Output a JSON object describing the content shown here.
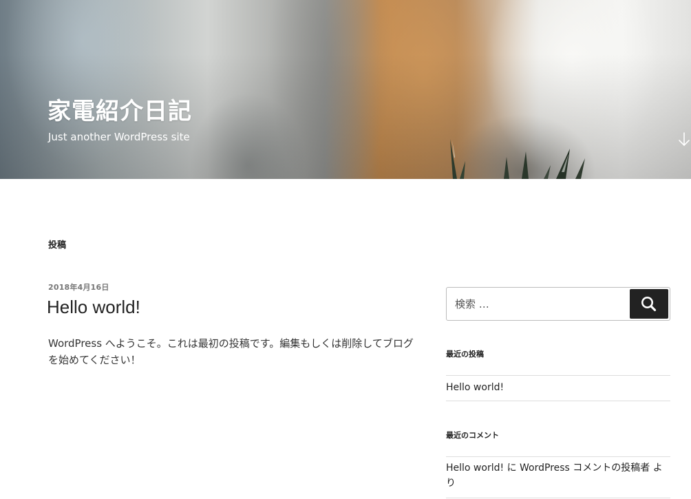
{
  "header": {
    "site_title": "家電紹介日記",
    "site_description": "Just another WordPress site",
    "scroll_icon": "arrow-down-icon"
  },
  "main": {
    "page_title": "投稿",
    "post": {
      "date": "2018年4月16日",
      "title": "Hello world!",
      "content": "WordPress へようこそ。これは最初の投稿です。編集もしくは削除してブログを始めてください！"
    }
  },
  "sidebar": {
    "search": {
      "placeholder": "検索 …",
      "value": "",
      "button_icon": "search-icon"
    },
    "recent_posts": {
      "title": "最近の投稿",
      "items": [
        "Hello world!"
      ]
    },
    "recent_comments": {
      "title": "最近のコメント",
      "items": [
        {
          "post": "Hello world!",
          "connector": "に",
          "author": "WordPress コメントの投稿者",
          "suffix": "より"
        }
      ]
    }
  },
  "colors": {
    "text": "#222222",
    "meta": "#767676",
    "button": "#222222",
    "rule": "#dddddd"
  }
}
